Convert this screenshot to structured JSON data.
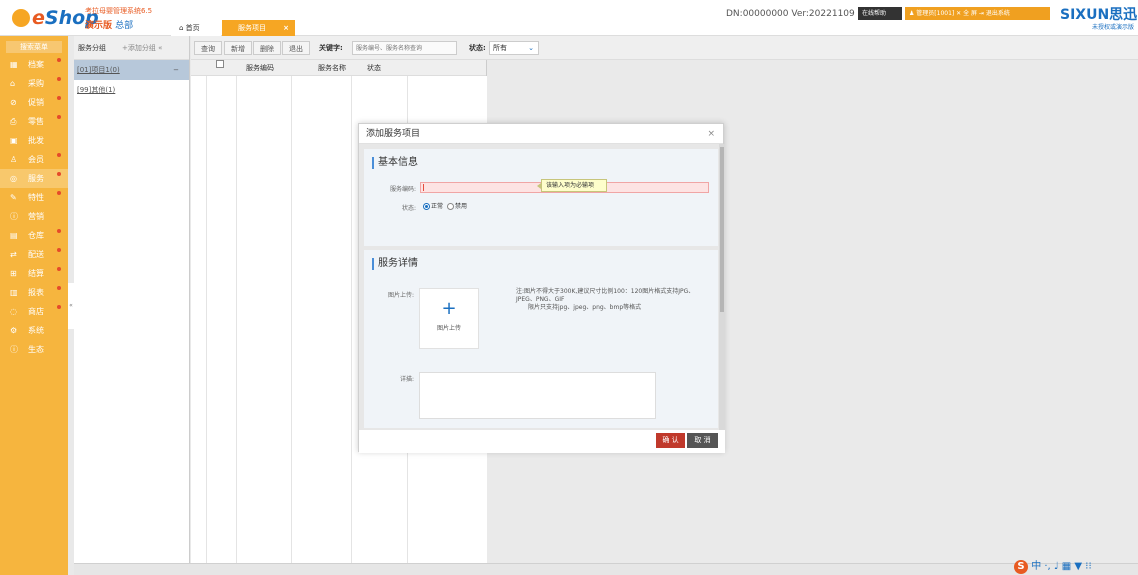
{
  "header": {
    "logo_prefix": "e",
    "logo_rest": "Shop",
    "product_name": "考拉母婴管理系统6.5",
    "edition": "演示版",
    "branch": "总部",
    "info": "DN:00000000  Ver:20221109",
    "help_btn": "在线帮助",
    "admin_bar": "♟ 管理员[1001]  ✕ 全 屏  ⇥ 退出系统",
    "brand": "SIXUN思迅",
    "unauth": "未授权或演示版"
  },
  "tabs": {
    "home": "首页",
    "service": "服务项目",
    "close": "×"
  },
  "sidebar": {
    "title": "搜索菜单",
    "items": [
      {
        "label": "档案",
        "icon": "▦"
      },
      {
        "label": "采购",
        "icon": "⌂"
      },
      {
        "label": "促销",
        "icon": "⊘"
      },
      {
        "label": "零售",
        "icon": "⎙"
      },
      {
        "label": "批发",
        "icon": "▣"
      },
      {
        "label": "会员",
        "icon": "♙"
      },
      {
        "label": "服务",
        "icon": "◎"
      },
      {
        "label": "特性",
        "icon": "✎"
      },
      {
        "label": "营销",
        "icon": "ⓘ"
      },
      {
        "label": "仓库",
        "icon": "▤"
      },
      {
        "label": "配送",
        "icon": "⇄"
      },
      {
        "label": "结算",
        "icon": "⊞"
      },
      {
        "label": "报表",
        "icon": "▥"
      },
      {
        "label": "商店",
        "icon": "◌"
      },
      {
        "label": "系统",
        "icon": "⚙"
      },
      {
        "label": "生态",
        "icon": "ⓘ"
      }
    ],
    "collapse": "«"
  },
  "tree": {
    "title": "服务分组",
    "add": "+添加分组",
    "collapse": "«",
    "nodes": [
      {
        "label": "[01]项目1(0)",
        "toggle": "−"
      },
      {
        "label": "[99]其他(1)"
      }
    ]
  },
  "toolbar": {
    "query": "查询",
    "add": "新增",
    "delete": "删除",
    "exit": "退出",
    "keyword_label": "关键字:",
    "keyword_placeholder": "服务编号、服务名称查询",
    "status_label": "状态:",
    "status_value": "所有",
    "chevron": "⌄"
  },
  "grid": {
    "columns": [
      "服务编码",
      "服务名称",
      "状态"
    ]
  },
  "modal": {
    "title": "添加服务项目",
    "close": "×",
    "basic_title": "基本信息",
    "code_label": "服务编码:",
    "tooltip": "该输入项为必输项",
    "status_label": "状态:",
    "radio_normal": "正常",
    "radio_disabled": "禁用",
    "detail_title": "服务详情",
    "img_label": "图片上传:",
    "upload_plus": "+",
    "upload_text": "图片上传",
    "note1": "注:图片不得大于300K,建议尺寸比例100：120图片格式支持JPG、JPEG、PNG、GIF",
    "note2": "限片只支持jpg、jpeg、png、bmp等格式",
    "detail_label": "详描:",
    "ok": "确 认",
    "cancel": "取 消"
  },
  "ime": {
    "s": "S",
    "tray": "中 ·, ♩ ▦ ▼ ⁝⁝"
  }
}
